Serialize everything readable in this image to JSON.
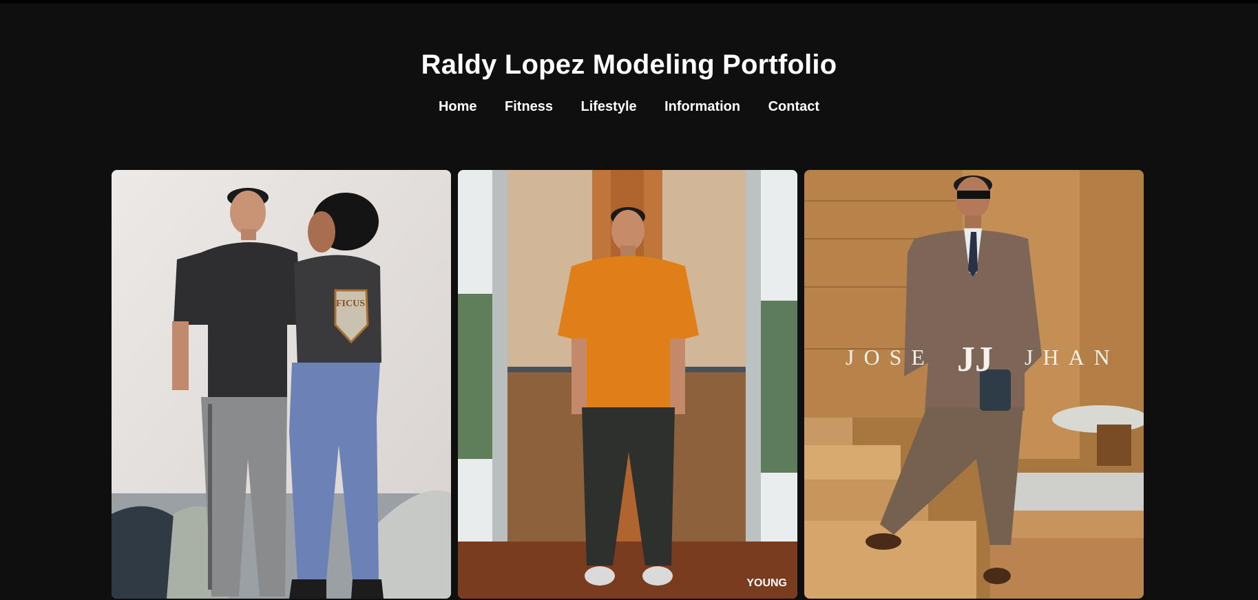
{
  "site": {
    "title": "Raldy Lopez Modeling Portfolio"
  },
  "nav": {
    "items": [
      {
        "label": "Home"
      },
      {
        "label": "Fitness"
      },
      {
        "label": "Lifestyle"
      },
      {
        "label": "Information"
      },
      {
        "label": "Contact"
      }
    ]
  },
  "gallery": {
    "photos": [
      {
        "subject": "couple-streetwear-photo",
        "shirt_text": "FICUS"
      },
      {
        "subject": "orange-tee-studio-photo",
        "watermark": "YOUNG"
      },
      {
        "subject": "brown-suit-editorial-photo",
        "overlay_left": "JOSE",
        "overlay_mark": "JJ",
        "overlay_right": "JHAN"
      }
    ]
  },
  "colors": {
    "background": "#0f0f0f",
    "text": "#ffffff",
    "top_strip": "#000000"
  }
}
